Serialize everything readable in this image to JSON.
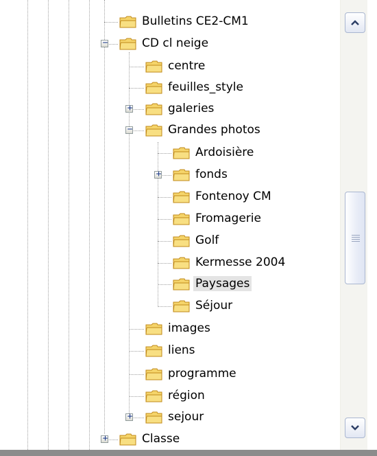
{
  "tree": {
    "items": [
      {
        "label": "Bulletins CE2-CM1",
        "toggle": ""
      },
      {
        "label": "CD cl neige",
        "toggle": "−"
      },
      {
        "label": "centre",
        "toggle": ""
      },
      {
        "label": "feuilles_style",
        "toggle": ""
      },
      {
        "label": "galeries",
        "toggle": "+"
      },
      {
        "label": "Grandes photos",
        "toggle": "−"
      },
      {
        "label": "Ardoisière",
        "toggle": ""
      },
      {
        "label": "fonds",
        "toggle": "+"
      },
      {
        "label": "Fontenoy CM",
        "toggle": ""
      },
      {
        "label": "Fromagerie",
        "toggle": ""
      },
      {
        "label": "Golf",
        "toggle": ""
      },
      {
        "label": "Kermesse 2004",
        "toggle": ""
      },
      {
        "label": "Paysages",
        "toggle": "",
        "selected": true
      },
      {
        "label": "Séjour",
        "toggle": ""
      },
      {
        "label": "images",
        "toggle": ""
      },
      {
        "label": "liens",
        "toggle": ""
      },
      {
        "label": "programme",
        "toggle": ""
      },
      {
        "label": "région",
        "toggle": ""
      },
      {
        "label": "sejour",
        "toggle": "+"
      },
      {
        "label": "Classe",
        "toggle": "+"
      }
    ]
  },
  "scrollbar": {
    "up_icon": "arrow-up-icon",
    "down_icon": "arrow-down-icon",
    "grip_icon": "grip-icon"
  },
  "colors": {
    "folder": "#f5d46a",
    "folder_edge": "#c08a1a",
    "selection": "#e4e4e4"
  }
}
